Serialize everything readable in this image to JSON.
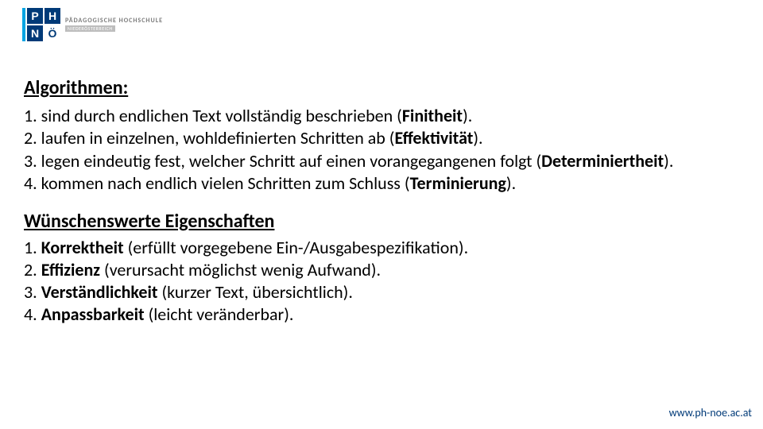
{
  "logo": {
    "cells": [
      "P",
      "H",
      "N",
      "Ö"
    ],
    "line1": "PÄDAGOGISCHE HOCHSCHULE",
    "line2": "NIEDERÖSTERREICH"
  },
  "section1": {
    "heading": "Algorithmen:",
    "items": [
      {
        "pre": "1. sind durch endlichen Text vollständig beschrieben (",
        "bold": "Finitheit",
        "post": ")."
      },
      {
        "pre": "2. laufen in einzelnen, wohldefinierten Schritten ab (",
        "bold": "Effektivität",
        "post": ")."
      },
      {
        "pre": "3. legen eindeutig fest, welcher Schritt auf einen vorangegangenen folgt (",
        "bold": "Determiniertheit",
        "post": ")."
      },
      {
        "pre": "4. kommen nach endlich vielen Schritten zum Schluss (",
        "bold": "Terminierung",
        "post": ")."
      }
    ]
  },
  "section2": {
    "heading": "Wünschenswerte Eigenschaften",
    "items": [
      {
        "num": "1. ",
        "bold": "Korrektheit",
        "post": " (erfüllt vorgegebene Ein-/Ausgabespezifikation)."
      },
      {
        "num": "2. ",
        "bold": "Effizienz",
        "post": " (verursacht möglichst wenig Aufwand)."
      },
      {
        "num": "3. ",
        "bold": "Verständlichkeit",
        "post": " (kurzer Text, übersichtlich)."
      },
      {
        "num": "4. ",
        "bold": "Anpassbarkeit",
        "post": " (leicht veränderbar)."
      }
    ]
  },
  "footer": {
    "url": "www.ph-noe.ac.at"
  }
}
